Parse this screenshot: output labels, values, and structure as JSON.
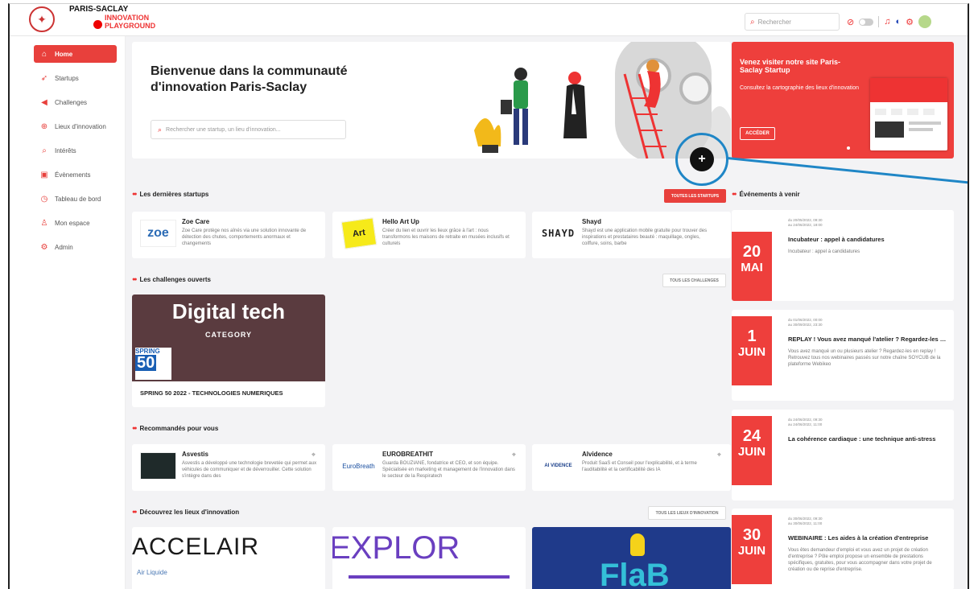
{
  "header": {
    "logo_line1": "PARIS-SACLAY",
    "logo_line2": "INNOVATION",
    "logo_line3": "PLAYGROUND",
    "search_placeholder": "Rechercher"
  },
  "sidebar": {
    "items": [
      {
        "label": "Home",
        "icon": "home-icon",
        "glyph": "⌂"
      },
      {
        "label": "Startups",
        "icon": "rocket-icon",
        "glyph": "➶"
      },
      {
        "label": "Challenges",
        "icon": "megaphone-icon",
        "glyph": "◀"
      },
      {
        "label": "Lieux d'innovation",
        "icon": "globe-icon",
        "glyph": "⊕"
      },
      {
        "label": "Intérêts",
        "icon": "search-icon",
        "glyph": "⌕"
      },
      {
        "label": "Évènements",
        "icon": "calendar-icon",
        "glyph": "▣"
      },
      {
        "label": "Tableau de bord",
        "icon": "clock-icon",
        "glyph": "◷"
      },
      {
        "label": "Mon espace",
        "icon": "user-icon",
        "glyph": "♙"
      },
      {
        "label": "Admin",
        "icon": "gear-icon",
        "glyph": "⚙"
      }
    ]
  },
  "hero": {
    "title": "Bienvenue dans la communauté d'innovation Paris-Saclay",
    "search_placeholder": "Rechercher une startup, un lieu d'innovation..."
  },
  "promo": {
    "title": "Venez visiter notre site Paris-Saclay Startup",
    "subtitle": "Consultez la cartographie des lieux d'innovation",
    "button": "ACCÉDER"
  },
  "plus_label": "+",
  "startups": {
    "heading": "Les dernières startups",
    "button": "TOUTES LES STARTUPS",
    "items": [
      {
        "name": "Zoe Care",
        "logo": "zoe",
        "desc": "Zoe Care protège nos aînés via une solution innovante de détection des chutes, comportements anormaux et changements"
      },
      {
        "name": "Hello Art Up",
        "logo": "Art",
        "desc": "Créer du lien et ouvrir les lieux grâce à l'art : nous transformons les maisons de retraite en musées inclusifs et culturels"
      },
      {
        "name": "Shayd",
        "logo": "SHAYD",
        "desc": "Shayd est une application mobile gratuite pour trouver des inspirations et prestataires beauté : maquillage, ongles, coiffure, soins, barbe"
      }
    ]
  },
  "challenges": {
    "heading": "Les challenges ouverts",
    "button": "TOUS LES CHALLENGES",
    "card_title": "Digital tech",
    "card_sub": "CATEGORY",
    "badge1": "SPRING",
    "badge2": "50",
    "name": "SPRING 50 2022 - TECHNOLOGIES NUMERIQUES"
  },
  "recommended": {
    "heading": "Recommandés pour vous",
    "items": [
      {
        "name": "Asvestis",
        "logo": "",
        "desc": "Asvestis a développé une technologie brevetée qui permet aux véhicules de communiquer et de déverrouiller. Cette solution s'intègre dans des"
      },
      {
        "name": "EUROBREATHIT",
        "logo": "EuroBreath",
        "desc": "Guarda BOUZIANE, fondatrice et CEO, et son équipe. Spécialisée en marketing et management de l'innovation dans le secteur de la Respiratech"
      },
      {
        "name": "Alvidence",
        "logo": "AI VIDENCE",
        "desc": "Produit SaaS et Conseil pour l'explicabilité, et à terme l'auditabilité et la certificabilité des IA"
      }
    ]
  },
  "lieux": {
    "heading": "Découvrez les lieux d'innovation",
    "button": "TOUS LES LIEUX D'INNOVATION",
    "items": [
      {
        "text": "ACCELAIR",
        "sub": "Air Liquide"
      },
      {
        "text": "EXPLOR"
      },
      {
        "text": "FlaB"
      }
    ]
  },
  "events": {
    "heading": "Événements à venir",
    "items": [
      {
        "day": "20",
        "month": "MAI",
        "range1": "du 20/05/2022, 09:30",
        "range2": "au 24/06/2022, 18:00",
        "title": "Incubateur : appel à candidatures",
        "desc": "Incubateur : appel à candidatures"
      },
      {
        "day": "1",
        "month": "JUIN",
        "range1": "du 01/06/2022, 00:00",
        "range2": "au 30/09/2022, 23:30",
        "title": "REPLAY ! Vous avez manqué l'atelier ? Regardez-les en replay !",
        "desc": "Vous avez manqué un ou plusieurs atelier ? Regardez-les en replay ! Retrouvez tous nos webinaires passés sur notre chaîne SOYCUB de la plateforme Webikeo"
      },
      {
        "day": "24",
        "month": "JUIN",
        "range1": "du 24/06/2022, 09:30",
        "range2": "au 24/06/2022, 11:00",
        "title": "La cohérence cardiaque : une technique anti-stress",
        "desc": ""
      },
      {
        "day": "30",
        "month": "JUIN",
        "range1": "du 30/06/2022, 09:30",
        "range2": "au 30/06/2022, 11:00",
        "title": "WEBINAIRE : Les aides à la création d'entreprise",
        "desc": "Vous êtes demandeur d'emploi et vous avez un projet de création d'entreprise ? Pôle emploi propose un ensemble de prestations spécifiques, gratuites, pour vous accompagner dans votre projet de création ou de reprise d'entreprise."
      }
    ]
  },
  "colors": {
    "accent": "#e8403c",
    "highlight": "#1f86c6"
  }
}
